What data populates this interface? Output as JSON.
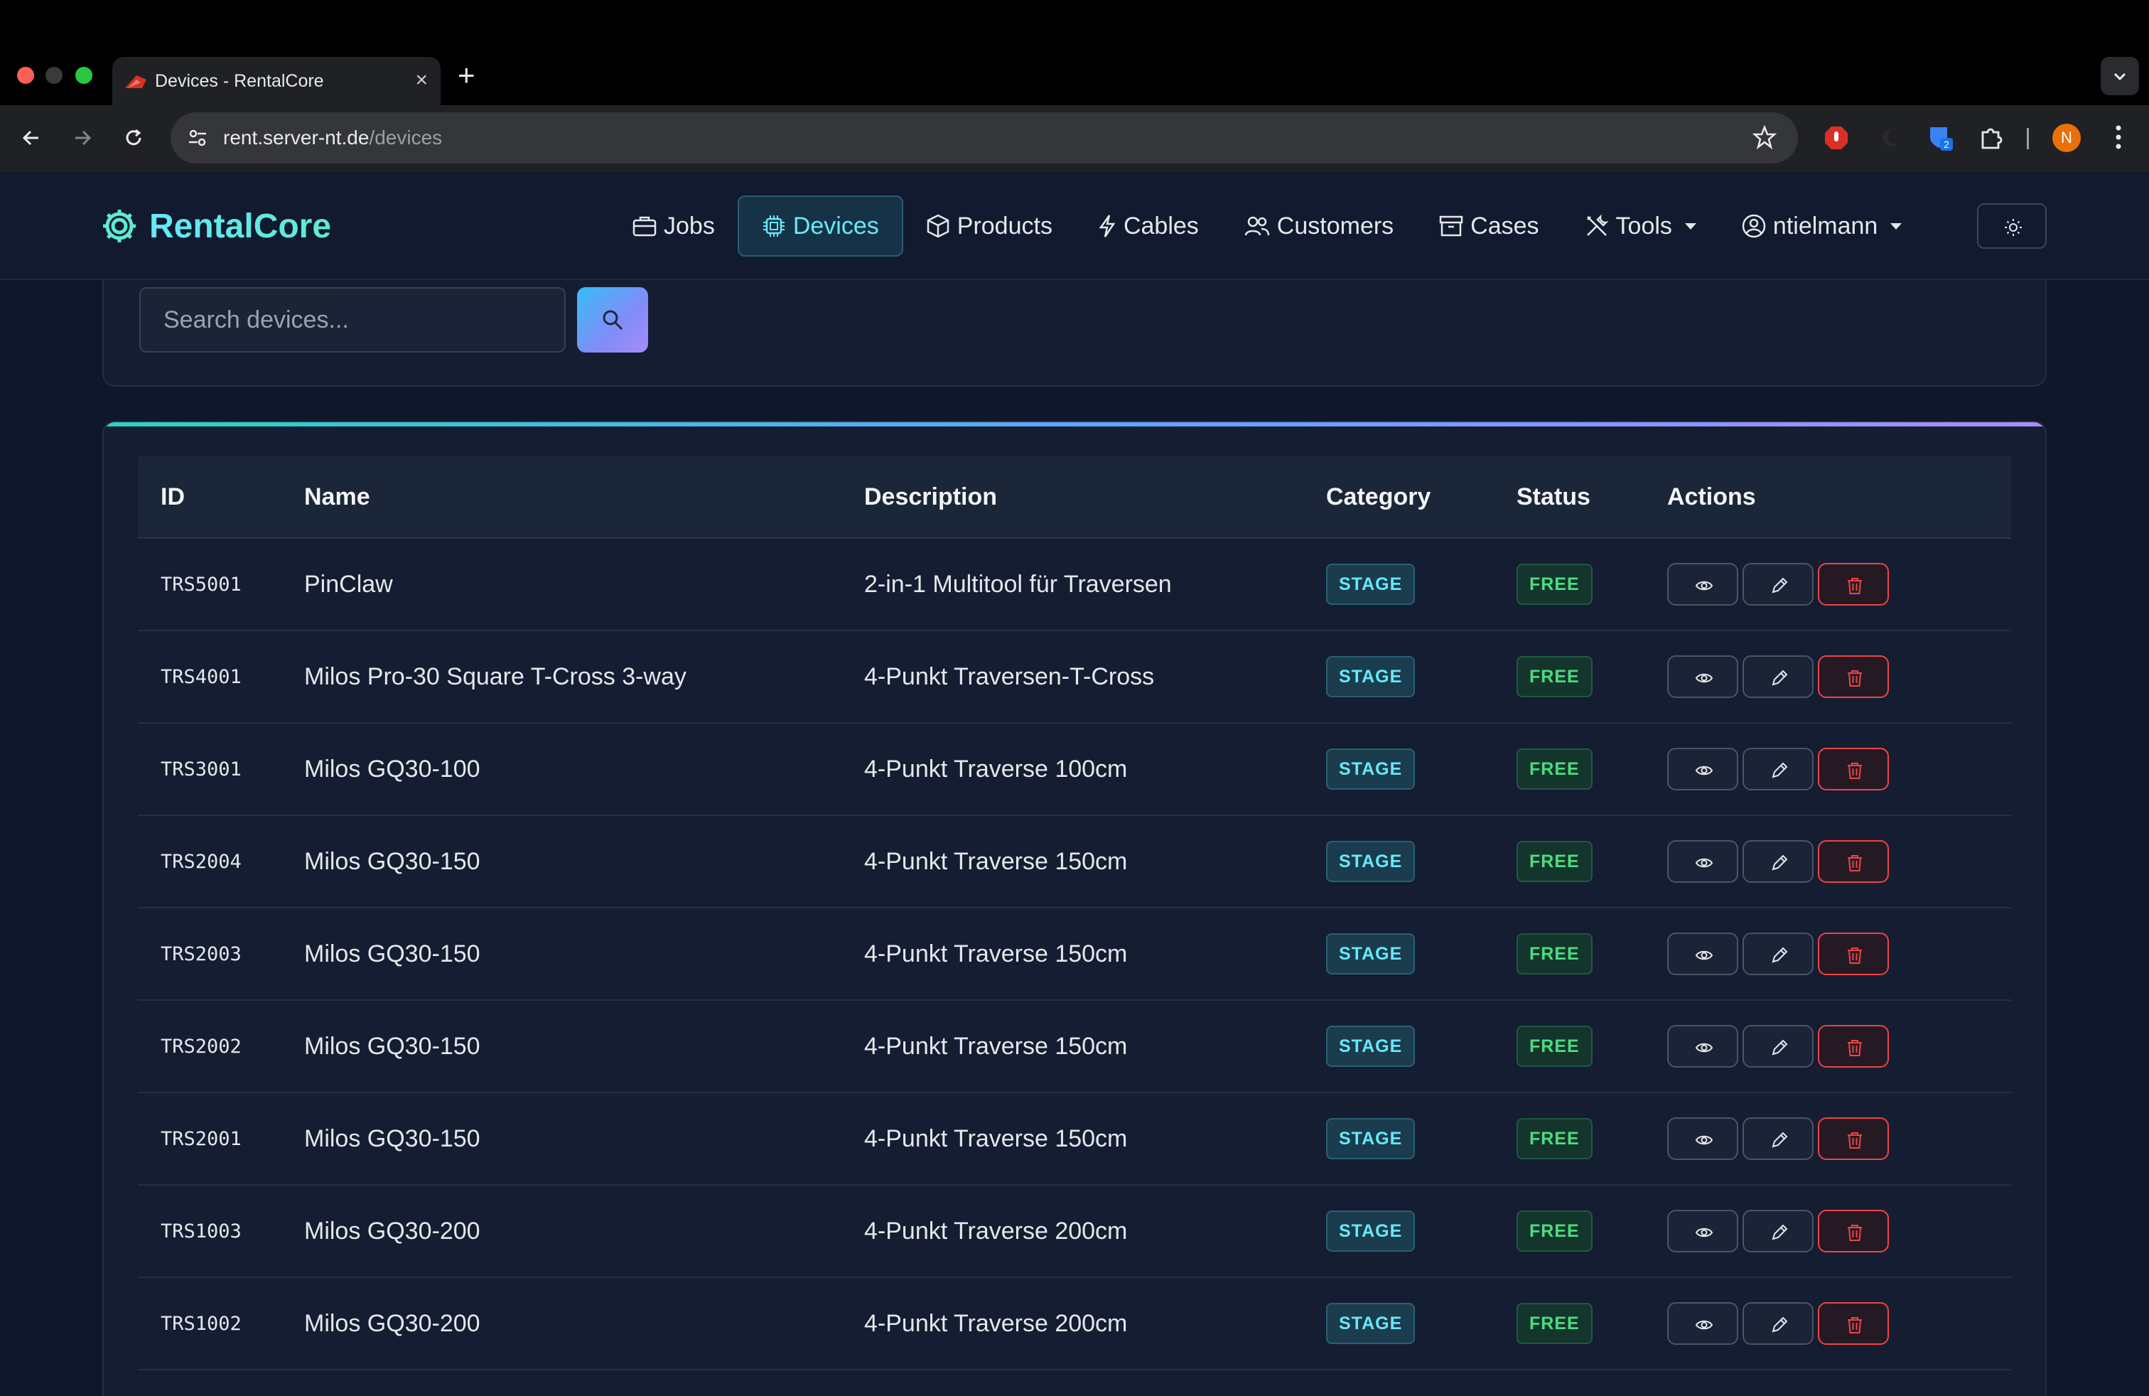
{
  "browser": {
    "tab_title": "Devices - RentalCore",
    "url_host": "rent.server-nt.de",
    "url_path": "/devices",
    "profile_initial": "N",
    "extension_badge": "2"
  },
  "app": {
    "brand": "RentalCore",
    "nav": [
      {
        "label": "Jobs",
        "icon": "briefcase-icon"
      },
      {
        "label": "Devices",
        "icon": "chip-icon",
        "active": true
      },
      {
        "label": "Products",
        "icon": "box-icon"
      },
      {
        "label": "Cables",
        "icon": "bolt-icon"
      },
      {
        "label": "Customers",
        "icon": "people-icon"
      },
      {
        "label": "Cases",
        "icon": "archive-icon"
      },
      {
        "label": "Tools",
        "icon": "tools-icon",
        "dropdown": true
      },
      {
        "label": "ntielmann",
        "icon": "user-icon",
        "dropdown": true
      }
    ],
    "accent": "#67e8f9"
  },
  "search": {
    "placeholder": "Search devices...",
    "value": ""
  },
  "table": {
    "headers": {
      "id": "ID",
      "name": "Name",
      "description": "Description",
      "category": "Category",
      "status": "Status",
      "actions": "Actions"
    },
    "rows": [
      {
        "id": "TRS5001",
        "name": "PinClaw",
        "description": "2-in-1 Multitool für Traversen",
        "category": "STAGE",
        "status": "FREE"
      },
      {
        "id": "TRS4001",
        "name": "Milos Pro-30 Square T-Cross 3-way",
        "description": "4-Punkt Traversen-T-Cross",
        "category": "STAGE",
        "status": "FREE"
      },
      {
        "id": "TRS3001",
        "name": "Milos GQ30-100",
        "description": "4-Punkt Traverse 100cm",
        "category": "STAGE",
        "status": "FREE"
      },
      {
        "id": "TRS2004",
        "name": "Milos GQ30-150",
        "description": "4-Punkt Traverse 150cm",
        "category": "STAGE",
        "status": "FREE"
      },
      {
        "id": "TRS2003",
        "name": "Milos GQ30-150",
        "description": "4-Punkt Traverse 150cm",
        "category": "STAGE",
        "status": "FREE"
      },
      {
        "id": "TRS2002",
        "name": "Milos GQ30-150",
        "description": "4-Punkt Traverse 150cm",
        "category": "STAGE",
        "status": "FREE"
      },
      {
        "id": "TRS2001",
        "name": "Milos GQ30-150",
        "description": "4-Punkt Traverse 150cm",
        "category": "STAGE",
        "status": "FREE"
      },
      {
        "id": "TRS1003",
        "name": "Milos GQ30-200",
        "description": "4-Punkt Traverse 200cm",
        "category": "STAGE",
        "status": "FREE"
      },
      {
        "id": "TRS1002",
        "name": "Milos GQ30-200",
        "description": "4-Punkt Traverse 200cm",
        "category": "STAGE",
        "status": "FREE"
      }
    ]
  }
}
